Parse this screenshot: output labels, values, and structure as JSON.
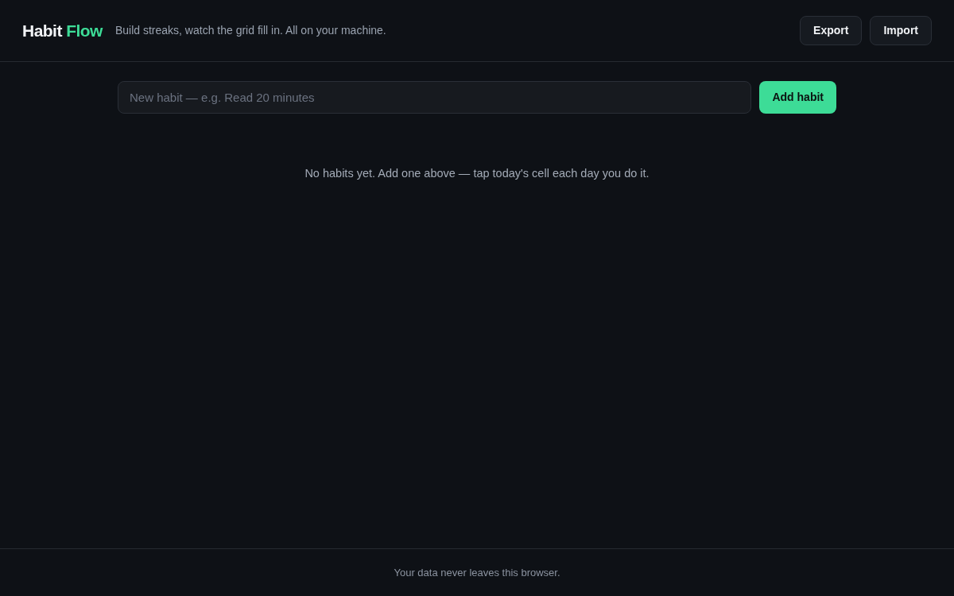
{
  "header": {
    "brand": {
      "first": "Habit",
      "second": "Flow"
    },
    "tagline": "Build streaks, watch the grid fill in. All on your machine.",
    "buttons": [
      "Export",
      "Import"
    ]
  },
  "add_form": {
    "placeholder": "New habit — e.g. Read 20 minutes",
    "button": "Add habit"
  },
  "empty_state": "No habits yet. Add one above — tap today's cell each day you do it.",
  "footer": "Your data never leaves this browser."
}
